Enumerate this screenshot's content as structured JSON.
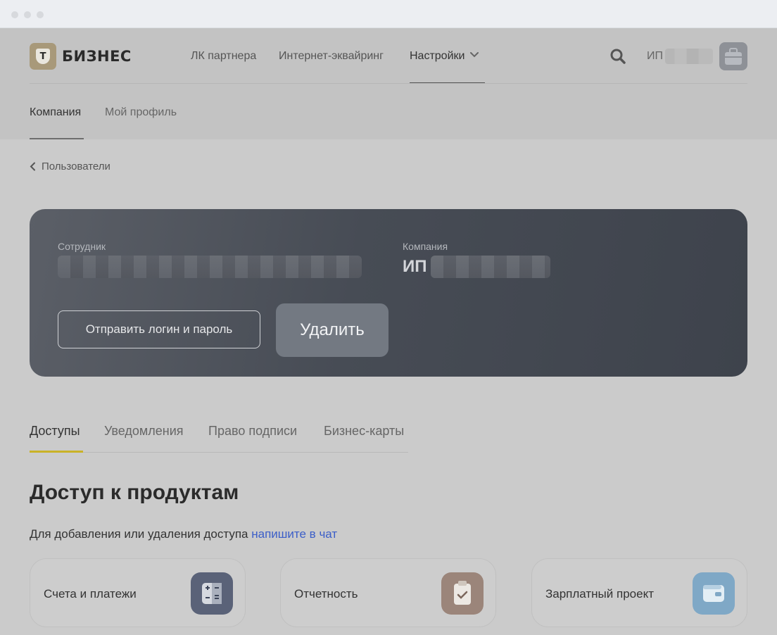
{
  "brand": {
    "logo_letter": "Т",
    "name": "БИЗНЕС"
  },
  "nav": {
    "items": [
      {
        "label": "ЛК партнера"
      },
      {
        "label": "Интернет-эквайринг"
      },
      {
        "label": "Настройки"
      }
    ],
    "org_prefix": "ИП"
  },
  "subnav": {
    "items": [
      {
        "label": "Компания"
      },
      {
        "label": "Мой профиль"
      }
    ]
  },
  "breadcrumb": {
    "back_label": "Пользователи"
  },
  "hero": {
    "employee_label": "Сотрудник",
    "company_label": "Компания",
    "company_prefix": "ИП",
    "send_credentials_label": "Отправить логин и пароль",
    "delete_label": "Удалить"
  },
  "tabs": [
    {
      "label": "Доступы"
    },
    {
      "label": "Уведомления"
    },
    {
      "label": "Право подписи"
    },
    {
      "label": "Бизнес-карты"
    }
  ],
  "section": {
    "title": "Доступ к продуктам",
    "subtitle": "Для добавления или удаления доступа ",
    "chat_link": "напишите в чат"
  },
  "products": [
    {
      "label": "Счета и платежи",
      "icon": "calculator-icon",
      "color": "#5a6278"
    },
    {
      "label": "Отчетность",
      "icon": "clipboard-check-icon",
      "color": "#9b857a"
    },
    {
      "label": "Зарплатный проект",
      "icon": "wallet-icon",
      "color": "#7fa8c6"
    }
  ]
}
